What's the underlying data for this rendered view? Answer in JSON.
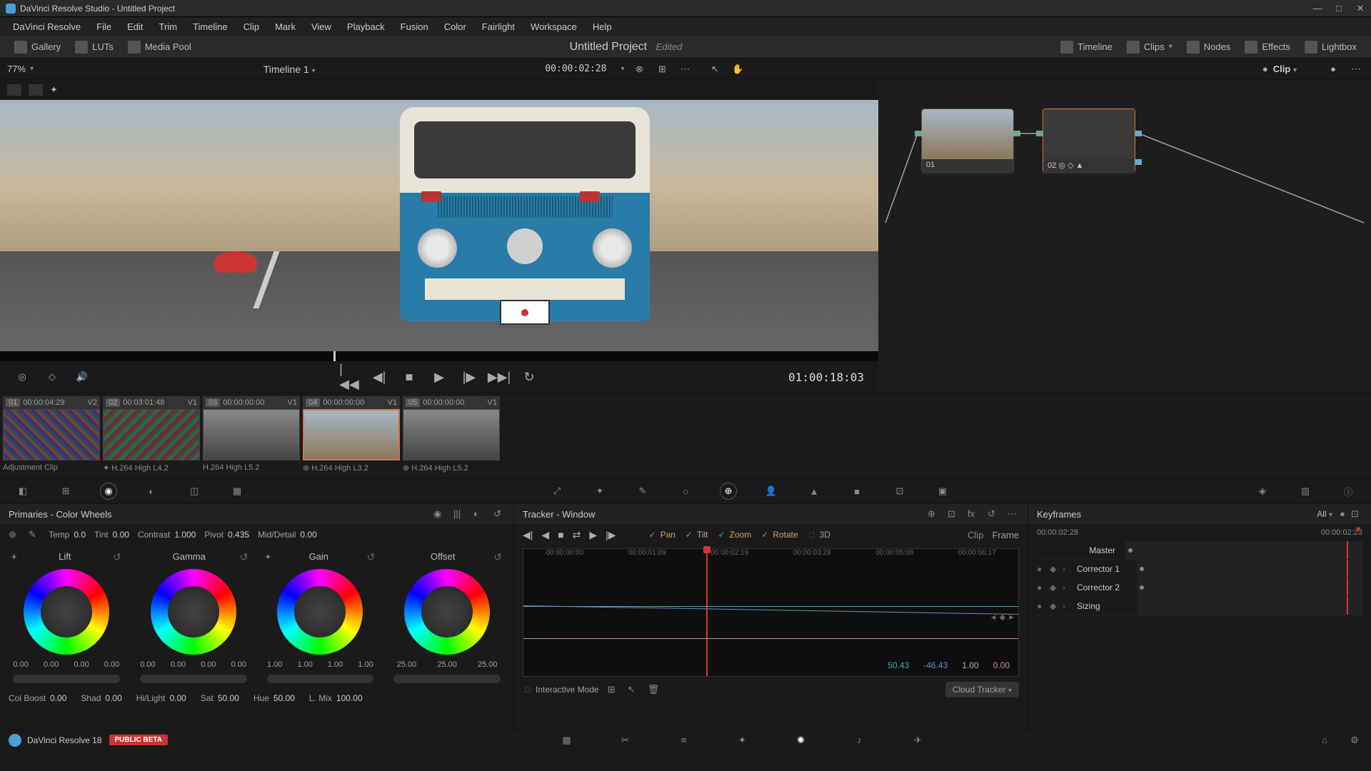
{
  "window": {
    "title": "DaVinci Resolve Studio - Untitled Project"
  },
  "menu": [
    "DaVinci Resolve",
    "File",
    "Edit",
    "Trim",
    "Timeline",
    "Clip",
    "Mark",
    "View",
    "Playback",
    "Fusion",
    "Color",
    "Fairlight",
    "Workspace",
    "Help"
  ],
  "toolbar": {
    "left": [
      "Gallery",
      "LUTs",
      "Media Pool"
    ],
    "project": "Untitled Project",
    "edited": "Edited",
    "right": [
      "Timeline",
      "Clips",
      "Nodes",
      "Effects",
      "Lightbox"
    ]
  },
  "sec_toolbar": {
    "zoom": "77%",
    "timeline_name": "Timeline 1",
    "timecode": "00:00:02:28",
    "mode": "Clip"
  },
  "transport": {
    "timecode": "01:00:18:03"
  },
  "nodes": [
    {
      "id": "01",
      "selected": false
    },
    {
      "id": "02",
      "selected": true
    }
  ],
  "clips": [
    {
      "num": "01",
      "tc": "00:00:04:29",
      "track": "V2",
      "codec": "Adjustment Clip",
      "active": false,
      "thumb": "adj"
    },
    {
      "num": "02",
      "tc": "00:03:01:48",
      "track": "V1",
      "codec": "H.264 High L4.2",
      "active": false,
      "thumb": "lut"
    },
    {
      "num": "03",
      "tc": "00:00:00:00",
      "track": "V1",
      "codec": "H.264 High L5.2",
      "active": false,
      "thumb": "scene"
    },
    {
      "num": "04",
      "tc": "00:00:00:00",
      "track": "V1",
      "codec": "H.264 High L3.2",
      "active": true,
      "thumb": "bus"
    },
    {
      "num": "05",
      "tc": "00:00:00:00",
      "track": "V1",
      "codec": "H.264 High L5.2",
      "active": false,
      "thumb": "scene"
    }
  ],
  "primaries": {
    "title": "Primaries - Color Wheels",
    "adjust": {
      "temp_label": "Temp",
      "temp": "0.0",
      "tint_label": "Tint",
      "tint": "0.00",
      "contrast_label": "Contrast",
      "contrast": "1.000",
      "pivot_label": "Pivot",
      "pivot": "0.435",
      "mid_label": "Mid/Detail",
      "mid": "0.00"
    },
    "wheels": [
      {
        "name": "Lift",
        "vals": [
          "0.00",
          "0.00",
          "0.00",
          "0.00"
        ]
      },
      {
        "name": "Gamma",
        "vals": [
          "0.00",
          "0.00",
          "0.00",
          "0.00"
        ]
      },
      {
        "name": "Gain",
        "vals": [
          "1.00",
          "1.00",
          "1.00",
          "1.00"
        ]
      },
      {
        "name": "Offset",
        "vals": [
          "25.00",
          "25.00",
          "25.00"
        ]
      }
    ],
    "bottom": {
      "colboost_label": "Col Boost",
      "colboost": "0.00",
      "shad_label": "Shad",
      "shad": "0.00",
      "hilight_label": "Hi/Light",
      "hilight": "0.00",
      "sat_label": "Sat",
      "sat": "50.00",
      "hue_label": "Hue",
      "hue": "50.00",
      "lmix_label": "L. Mix",
      "lmix": "100.00"
    }
  },
  "tracker": {
    "title": "Tracker - Window",
    "opts": {
      "pan": "Pan",
      "tilt": "Tilt",
      "zoom": "Zoom",
      "rotate": "Rotate",
      "3d": "3D",
      "pan_on": true,
      "tilt_on": true,
      "zoom_on": true,
      "rotate_on": true,
      "3d_on": false
    },
    "mode_clip": "Clip",
    "mode_frame": "Frame",
    "ticks": [
      "00:00:00:00",
      "00:00:01:09",
      "00:00:02:19",
      "00:00:03:28",
      "00:00:05:08",
      "00:00:06:17"
    ],
    "vals": {
      "pan": "50.43",
      "tilt": "-46.43",
      "zoom": "1.00",
      "rot": "0.00"
    },
    "interactive": "Interactive Mode",
    "cloud": "Cloud Tracker"
  },
  "keyframes": {
    "title": "Keyframes",
    "filter": "All",
    "tc_left": "00:00:02:28",
    "tc_right": "00:00:02:23",
    "rows": [
      "Master",
      "Corrector 1",
      "Corrector 2",
      "Sizing"
    ]
  },
  "status": {
    "version": "DaVinci Resolve 18",
    "beta": "PUBLIC BETA"
  }
}
